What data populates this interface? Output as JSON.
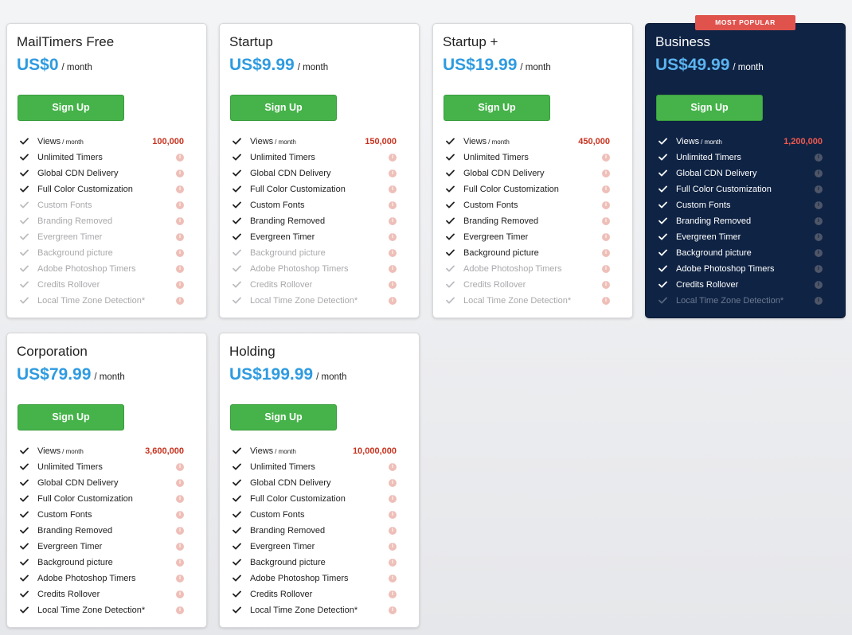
{
  "badge_most_popular": "MOST POPULAR",
  "colors": {
    "price_blue": "#2e9be0",
    "button_green": "#45b349",
    "value_red": "#c8321f",
    "featured_bg": "#0f2344",
    "badge_red": "#e0534d"
  },
  "icons": {
    "check": "check-icon",
    "info": "info-icon"
  },
  "plans": [
    {
      "name": "MailTimers Free",
      "price": "US$0",
      "period": "/ month",
      "cta": "Sign Up",
      "features": [
        {
          "label": "Views",
          "sub": "/ month",
          "value": "100,000",
          "included": true
        },
        {
          "label": "Unlimited Timers",
          "included": true
        },
        {
          "label": "Global CDN Delivery",
          "included": true
        },
        {
          "label": "Full Color Customization",
          "included": true
        },
        {
          "label": "Custom Fonts",
          "included": false
        },
        {
          "label": "Branding Removed",
          "included": false
        },
        {
          "label": "Evergreen Timer",
          "included": false
        },
        {
          "label": "Background picture",
          "included": false
        },
        {
          "label": "Adobe Photoshop Timers",
          "included": false
        },
        {
          "label": "Credits Rollover",
          "included": false
        },
        {
          "label": "Local Time Zone Detection*",
          "included": false
        }
      ]
    },
    {
      "name": "Startup",
      "price": "US$9.99",
      "period": "/ month",
      "cta": "Sign Up",
      "features": [
        {
          "label": "Views",
          "sub": "/ month",
          "value": "150,000",
          "included": true
        },
        {
          "label": "Unlimited Timers",
          "included": true
        },
        {
          "label": "Global CDN Delivery",
          "included": true
        },
        {
          "label": "Full Color Customization",
          "included": true
        },
        {
          "label": "Custom Fonts",
          "included": true
        },
        {
          "label": "Branding Removed",
          "included": true
        },
        {
          "label": "Evergreen Timer",
          "included": true
        },
        {
          "label": "Background picture",
          "included": false
        },
        {
          "label": "Adobe Photoshop Timers",
          "included": false
        },
        {
          "label": "Credits Rollover",
          "included": false
        },
        {
          "label": "Local Time Zone Detection*",
          "included": false
        }
      ]
    },
    {
      "name": "Startup +",
      "price": "US$19.99",
      "period": "/ month",
      "cta": "Sign Up",
      "features": [
        {
          "label": "Views",
          "sub": "/ month",
          "value": "450,000",
          "included": true
        },
        {
          "label": "Unlimited Timers",
          "included": true
        },
        {
          "label": "Global CDN Delivery",
          "included": true
        },
        {
          "label": "Full Color Customization",
          "included": true
        },
        {
          "label": "Custom Fonts",
          "included": true
        },
        {
          "label": "Branding Removed",
          "included": true
        },
        {
          "label": "Evergreen Timer",
          "included": true
        },
        {
          "label": "Background picture",
          "included": true
        },
        {
          "label": "Adobe Photoshop Timers",
          "included": false
        },
        {
          "label": "Credits Rollover",
          "included": false
        },
        {
          "label": "Local Time Zone Detection*",
          "included": false
        }
      ]
    },
    {
      "name": "Business",
      "price": "US$49.99",
      "period": "/ month",
      "cta": "Sign Up",
      "features": [
        {
          "label": "Views",
          "sub": "/ month",
          "value": "1,200,000",
          "included": true
        },
        {
          "label": "Unlimited Timers",
          "included": true
        },
        {
          "label": "Global CDN Delivery",
          "included": true
        },
        {
          "label": "Full Color Customization",
          "included": true
        },
        {
          "label": "Custom Fonts",
          "included": true
        },
        {
          "label": "Branding Removed",
          "included": true
        },
        {
          "label": "Evergreen Timer",
          "included": true
        },
        {
          "label": "Background picture",
          "included": true
        },
        {
          "label": "Adobe Photoshop Timers",
          "included": true
        },
        {
          "label": "Credits Rollover",
          "included": true
        },
        {
          "label": "Local Time Zone Detection*",
          "included": false
        }
      ]
    },
    {
      "name": "Corporation",
      "price": "US$79.99",
      "period": "/ month",
      "cta": "Sign Up",
      "features": [
        {
          "label": "Views",
          "sub": "/ month",
          "value": "3,600,000",
          "included": true
        },
        {
          "label": "Unlimited Timers",
          "included": true
        },
        {
          "label": "Global CDN Delivery",
          "included": true
        },
        {
          "label": "Full Color Customization",
          "included": true
        },
        {
          "label": "Custom Fonts",
          "included": true
        },
        {
          "label": "Branding Removed",
          "included": true
        },
        {
          "label": "Evergreen Timer",
          "included": true
        },
        {
          "label": "Background picture",
          "included": true
        },
        {
          "label": "Adobe Photoshop Timers",
          "included": true
        },
        {
          "label": "Credits Rollover",
          "included": true
        },
        {
          "label": "Local Time Zone Detection*",
          "included": true
        }
      ]
    },
    {
      "name": "Holding",
      "price": "US$199.99",
      "period": "/ month",
      "cta": "Sign Up",
      "features": [
        {
          "label": "Views",
          "sub": "/ month",
          "value": "10,000,000",
          "included": true
        },
        {
          "label": "Unlimited Timers",
          "included": true
        },
        {
          "label": "Global CDN Delivery",
          "included": true
        },
        {
          "label": "Full Color Customization",
          "included": true
        },
        {
          "label": "Custom Fonts",
          "included": true
        },
        {
          "label": "Branding Removed",
          "included": true
        },
        {
          "label": "Evergreen Timer",
          "included": true
        },
        {
          "label": "Background picture",
          "included": true
        },
        {
          "label": "Adobe Photoshop Timers",
          "included": true
        },
        {
          "label": "Credits Rollover",
          "included": true
        },
        {
          "label": "Local Time Zone Detection*",
          "included": true
        }
      ]
    }
  ]
}
